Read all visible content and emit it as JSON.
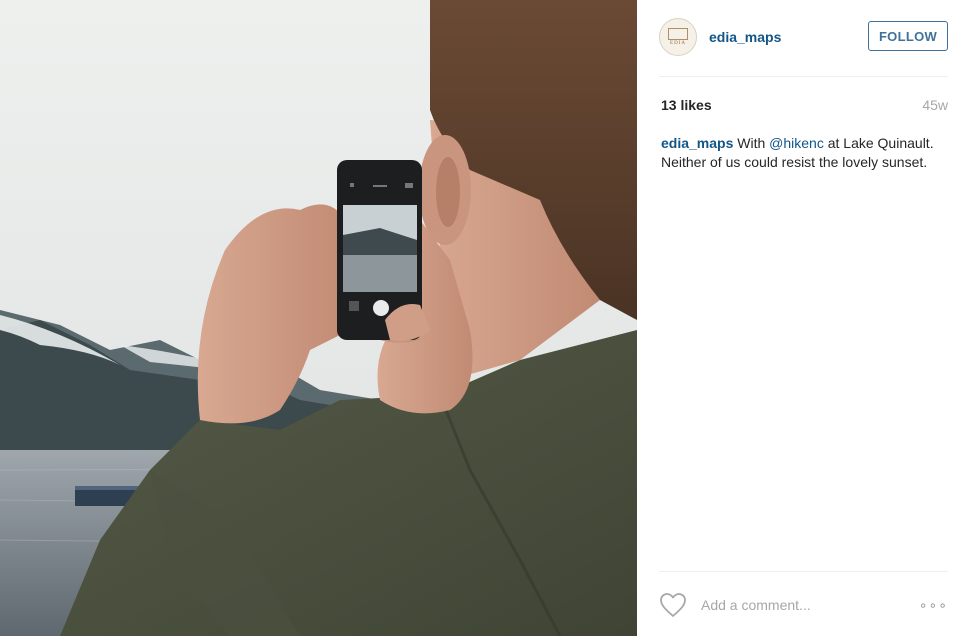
{
  "post": {
    "photo_alt": "",
    "account": {
      "avatar_text": "EDIA",
      "username": "edia_maps",
      "follow_label": "FOLLOW"
    },
    "likes": "13 likes",
    "age": "45w",
    "caption": {
      "username": "edia_maps",
      "text_before": " With ",
      "mention": "@hikenc",
      "text_after": " at Lake Quinault. Neither of us could resist the lovely sunset."
    },
    "footer": {
      "comment_placeholder": "Add a comment...",
      "more_label": "∘∘∘",
      "like_icon": "heart-outline-icon"
    },
    "colors": {
      "link": "#125688",
      "follow": "#3f729b",
      "muted": "#a5a7aa"
    }
  }
}
